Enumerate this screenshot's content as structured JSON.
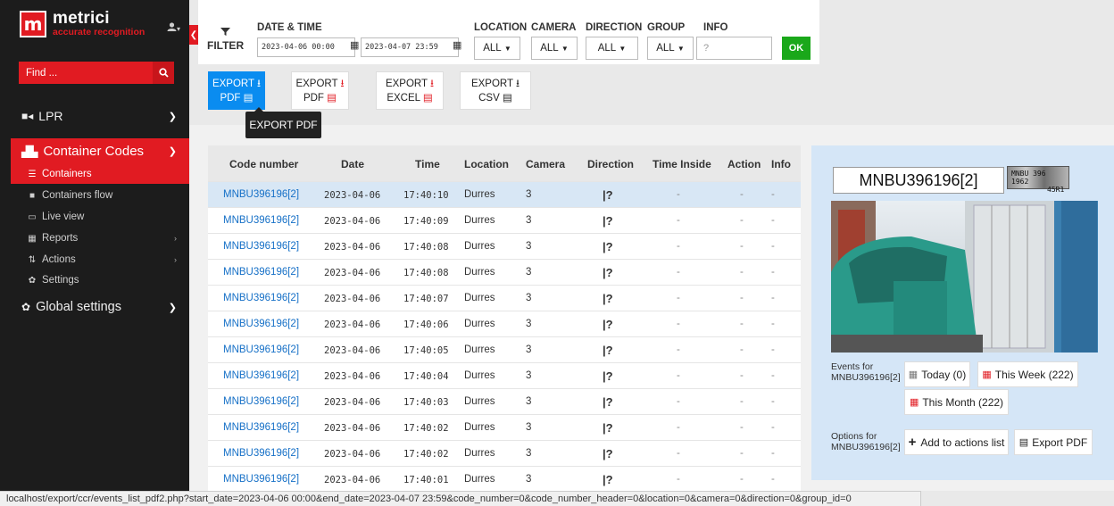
{
  "brand": {
    "name": "metrici",
    "tagline": "accurate recognition",
    "logo_letter": "m"
  },
  "sidebar": {
    "find_placeholder": "Find ...",
    "lpr": "LPR",
    "container_codes": "Container Codes",
    "sub_items": [
      {
        "label": "Containers",
        "icon": "list-icon"
      },
      {
        "label": "Containers flow",
        "icon": "video-icon"
      },
      {
        "label": "Live view",
        "icon": "monitor-icon"
      },
      {
        "label": "Reports",
        "icon": "chart-icon"
      },
      {
        "label": "Actions",
        "icon": "actions-icon"
      },
      {
        "label": "Settings",
        "icon": "gear-icon"
      }
    ],
    "global_settings": "Global settings"
  },
  "filters": {
    "filter_label": "FILTER",
    "date_time_label": "DATE & TIME",
    "start_date": "2023-04-06 00:00",
    "end_date": "2023-04-07 23:59",
    "location_label": "LOCATION",
    "camera_label": "CAMERA",
    "direction_label": "DIRECTION",
    "group_label": "GROUP",
    "info_label": "INFO",
    "location_value": "ALL",
    "camera_value": "ALL",
    "direction_value": "ALL",
    "group_value": "ALL",
    "info_placeholder": "?",
    "ok_label": "OK"
  },
  "exports": [
    {
      "line1": "EXPORT",
      "line2": "PDF"
    },
    {
      "line1": "EXPORT",
      "line2": "PDF"
    },
    {
      "line1": "EXPORT",
      "line2": "EXCEL"
    },
    {
      "line1": "EXPORT",
      "line2": "CSV"
    }
  ],
  "tooltip": "EXPORT PDF",
  "table": {
    "headers": [
      "Code number",
      "Date",
      "Time",
      "Location",
      "Camera",
      "Direction",
      "Time Inside",
      "Action",
      "Info"
    ],
    "rows": [
      {
        "code": "MNBU396196[2]",
        "date": "2023-04-06",
        "time": "17:40:10",
        "location": "Durres",
        "camera": "3",
        "direction": "|?",
        "inside": "-",
        "action": "-",
        "info": "-"
      },
      {
        "code": "MNBU396196[2]",
        "date": "2023-04-06",
        "time": "17:40:09",
        "location": "Durres",
        "camera": "3",
        "direction": "|?",
        "inside": "-",
        "action": "-",
        "info": "-"
      },
      {
        "code": "MNBU396196[2]",
        "date": "2023-04-06",
        "time": "17:40:08",
        "location": "Durres",
        "camera": "3",
        "direction": "|?",
        "inside": "-",
        "action": "-",
        "info": "-"
      },
      {
        "code": "MNBU396196[2]",
        "date": "2023-04-06",
        "time": "17:40:08",
        "location": "Durres",
        "camera": "3",
        "direction": "|?",
        "inside": "-",
        "action": "-",
        "info": "-"
      },
      {
        "code": "MNBU396196[2]",
        "date": "2023-04-06",
        "time": "17:40:07",
        "location": "Durres",
        "camera": "3",
        "direction": "|?",
        "inside": "-",
        "action": "-",
        "info": "-"
      },
      {
        "code": "MNBU396196[2]",
        "date": "2023-04-06",
        "time": "17:40:06",
        "location": "Durres",
        "camera": "3",
        "direction": "|?",
        "inside": "-",
        "action": "-",
        "info": "-"
      },
      {
        "code": "MNBU396196[2]",
        "date": "2023-04-06",
        "time": "17:40:05",
        "location": "Durres",
        "camera": "3",
        "direction": "|?",
        "inside": "-",
        "action": "-",
        "info": "-"
      },
      {
        "code": "MNBU396196[2]",
        "date": "2023-04-06",
        "time": "17:40:04",
        "location": "Durres",
        "camera": "3",
        "direction": "|?",
        "inside": "-",
        "action": "-",
        "info": "-"
      },
      {
        "code": "MNBU396196[2]",
        "date": "2023-04-06",
        "time": "17:40:03",
        "location": "Durres",
        "camera": "3",
        "direction": "|?",
        "inside": "-",
        "action": "-",
        "info": "-"
      },
      {
        "code": "MNBU396196[2]",
        "date": "2023-04-06",
        "time": "17:40:02",
        "location": "Durres",
        "camera": "3",
        "direction": "|?",
        "inside": "-",
        "action": "-",
        "info": "-"
      },
      {
        "code": "MNBU396196[2]",
        "date": "2023-04-06",
        "time": "17:40:02",
        "location": "Durres",
        "camera": "3",
        "direction": "|?",
        "inside": "-",
        "action": "-",
        "info": "-"
      },
      {
        "code": "MNBU396196[2]",
        "date": "2023-04-06",
        "time": "17:40:01",
        "location": "Durres",
        "camera": "3",
        "direction": "|?",
        "inside": "-",
        "action": "-",
        "info": "-"
      }
    ]
  },
  "panel": {
    "plate_code": "MNBU396196[2]",
    "plate_image_line1": "MNBU 396 1962",
    "plate_image_line2": "45R1",
    "events_for_label": "Events for",
    "events_for_code": "MNBU396196[2]",
    "today": "Today (0)",
    "this_week": "This Week (222)",
    "this_month": "This Month (222)",
    "options_for_label": "Options for",
    "options_for_code": "MNBU396196[2]",
    "add_to_actions": "Add to actions list",
    "export_pdf": "Export PDF"
  },
  "status_url": "localhost/export/ccr/events_list_pdf2.php?start_date=2023-04-06 00:00&end_date=2023-04-07 23:59&code_number=0&code_number_header=0&location=0&camera=0&direction=0&group_id=0"
}
